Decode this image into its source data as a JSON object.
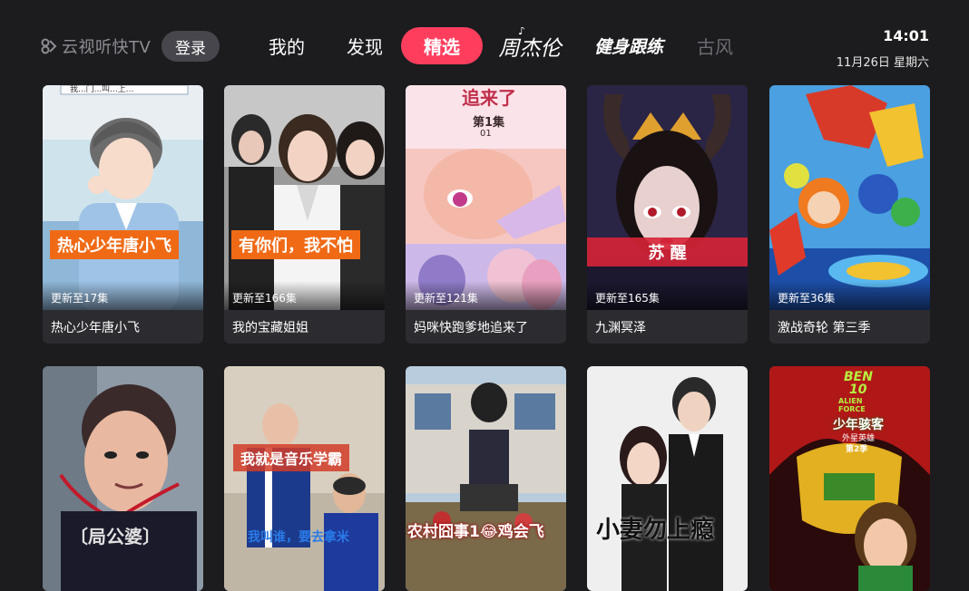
{
  "header": {
    "logo_text": "云视听快TV",
    "login_label": "登录",
    "nav": [
      "我的",
      "发现",
      "精选",
      "周杰伦",
      "健身跟练",
      "古风"
    ],
    "active_tab": "精选",
    "time": "14:01",
    "date": "11月26日 星期六"
  },
  "cards": [
    {
      "title": "热心少年唐小飞",
      "update": "更新至17集",
      "caption": "热心少年唐小飞",
      "poster_top_text": "我...门...叫...上..."
    },
    {
      "title": "我的宝藏姐姐",
      "update": "更新至166集",
      "caption": "有你们，我不怕"
    },
    {
      "title": "妈咪快跑爹地追来了",
      "update": "更新至121集",
      "poster_top_text": "追来了",
      "poster_episode": "第1集",
      "poster_episode_num": "01"
    },
    {
      "title": "九渊冥泽",
      "update": "更新至165集",
      "caption": "苏 醒"
    },
    {
      "title": "激战奇轮 第三季",
      "update": "更新至36集"
    },
    {
      "poster_bottom_text": "〔局公婆〕"
    },
    {
      "caption": "我就是音乐学霸",
      "poster_bottom_text": "我叫谁，要去拿米"
    },
    {
      "poster_bottom_text": "农村囧事1😂鸡会飞"
    },
    {
      "poster_bottom_text": "小妻勿上瘾"
    },
    {
      "poster_logo_line1": "BEN",
      "poster_logo_line2": "10",
      "poster_logo_sub": "ALIEN FORCE",
      "poster_title": "少年骇客",
      "poster_subtitle": "外星英雄",
      "poster_season": "第2季"
    }
  ],
  "colors": {
    "background": "#1c1c1f",
    "active_tab": "#ff3e5e",
    "card_bg": "#2c2c30",
    "caption_orange": "#f06a16"
  }
}
